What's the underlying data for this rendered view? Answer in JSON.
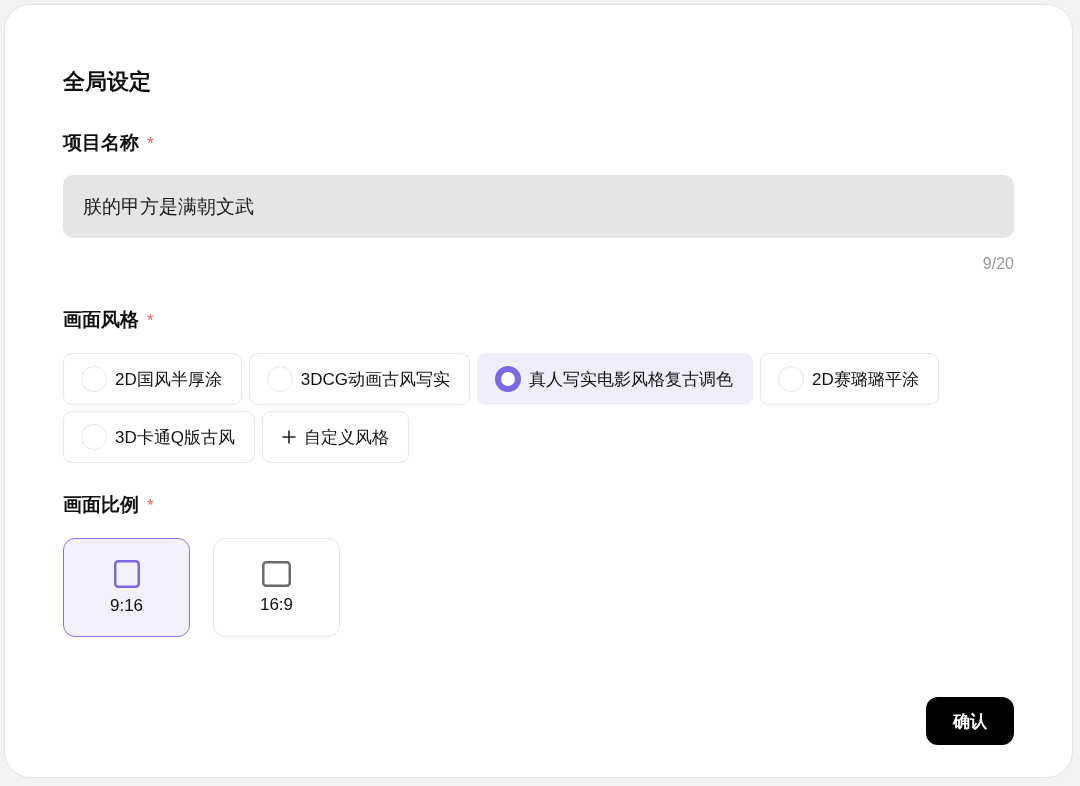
{
  "title": "全局设定",
  "project_name": {
    "label": "项目名称",
    "required_mark": "*",
    "value": "朕的甲方是满朝文武",
    "counter": "9/20"
  },
  "style": {
    "label": "画面风格",
    "required_mark": "*",
    "options": [
      {
        "label": "2D国风半厚涂",
        "selected": false
      },
      {
        "label": "3DCG动画古风写实",
        "selected": false
      },
      {
        "label": "真人写实电影风格复古调色",
        "selected": true
      },
      {
        "label": "2D赛璐璐平涂",
        "selected": false
      },
      {
        "label": "3D卡通Q版古风",
        "selected": false
      }
    ],
    "custom_button": {
      "label": "自定义风格"
    }
  },
  "aspect_ratio": {
    "label": "画面比例",
    "required_mark": "*",
    "options": [
      {
        "label": "9:16",
        "kind": "portrait",
        "selected": true
      },
      {
        "label": "16:9",
        "kind": "landscape",
        "selected": false
      }
    ]
  },
  "confirm_button": "确认"
}
